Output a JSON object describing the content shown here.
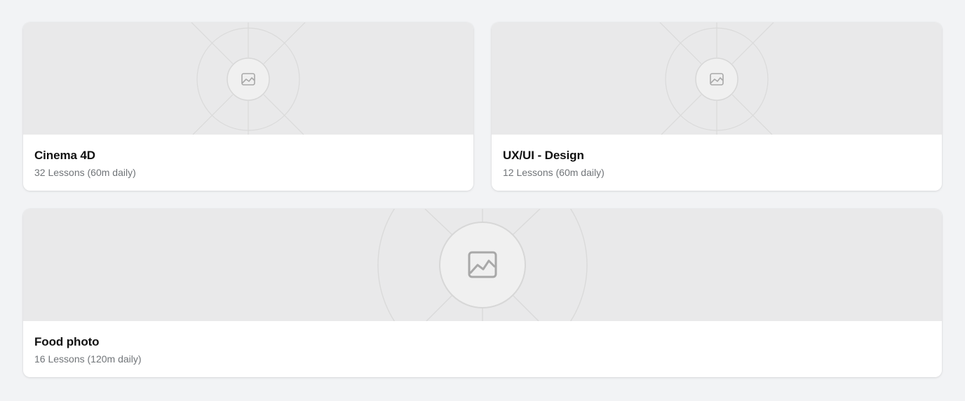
{
  "colors": {
    "page_background": "#f2f3f5",
    "card_background": "#ffffff",
    "thumbnail_background": "#e9e9ea",
    "title_text": "#111111",
    "subtitle_text": "#707478",
    "placeholder_icon": "#a8a8a8"
  },
  "courses": [
    {
      "title": "Cinema 4D",
      "subtitle": "32 Lessons (60m daily)",
      "thumbnail_icon": "image-placeholder-icon"
    },
    {
      "title": "UX/UI - Design",
      "subtitle": "12 Lessons (60m daily)",
      "thumbnail_icon": "image-placeholder-icon"
    },
    {
      "title": "Food photo",
      "subtitle": "16 Lessons (120m daily)",
      "thumbnail_icon": "image-placeholder-icon"
    }
  ]
}
